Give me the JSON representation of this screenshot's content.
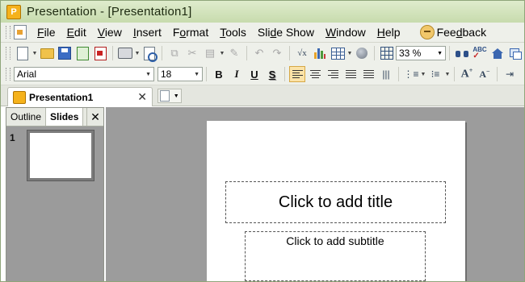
{
  "window": {
    "title": "Presentation - [Presentation1]",
    "app_icon": "presentation-app-icon",
    "accent": "#c7dbad"
  },
  "menubar": {
    "items": [
      {
        "key": "F",
        "rest": "ile"
      },
      {
        "key": "E",
        "rest": "dit"
      },
      {
        "key": "V",
        "rest": "iew"
      },
      {
        "key": "I",
        "rest": "nsert"
      },
      {
        "key": "",
        "pre": "F",
        "mid": "o",
        "post": "rmat"
      },
      {
        "key": "T",
        "rest": "ools"
      },
      {
        "pre": "Sli",
        "mid": "d",
        "post": "e Show"
      },
      {
        "key": "W",
        "rest": "indow"
      },
      {
        "key": "H",
        "rest": "elp"
      }
    ],
    "feedback": {
      "pre": "Fee",
      "mid": "d",
      "post": "back"
    }
  },
  "toolbar": {
    "zoom": "33 %",
    "icons": [
      "new-icon",
      "open-folder-icon",
      "save-icon",
      "export-icon",
      "pdf-icon",
      "print-icon",
      "print-preview-icon",
      "copy-icon",
      "cut-icon",
      "paste-icon",
      "format-painter-icon",
      "undo-icon",
      "redo-icon",
      "formula-icon",
      "chart-icon",
      "table-icon",
      "hyperlink-icon",
      "grid-icon",
      "find-icon",
      "spell-check-icon",
      "home-icon",
      "window-icon"
    ]
  },
  "format_toolbar": {
    "font_name": "Arial",
    "font_size": "18",
    "bold": "B",
    "italic": "I",
    "underline": "U",
    "shadow": "S",
    "align": "left"
  },
  "tabs": {
    "document": "Presentation1",
    "close": "✕"
  },
  "sidepane": {
    "tabs": [
      "Outline",
      "Slides"
    ],
    "active_tab": "Slides",
    "close": "✕",
    "slides": [
      {
        "number": "1"
      }
    ]
  },
  "slide": {
    "title_placeholder": "Click to add title",
    "subtitle_placeholder": "Click to add subtitle"
  }
}
